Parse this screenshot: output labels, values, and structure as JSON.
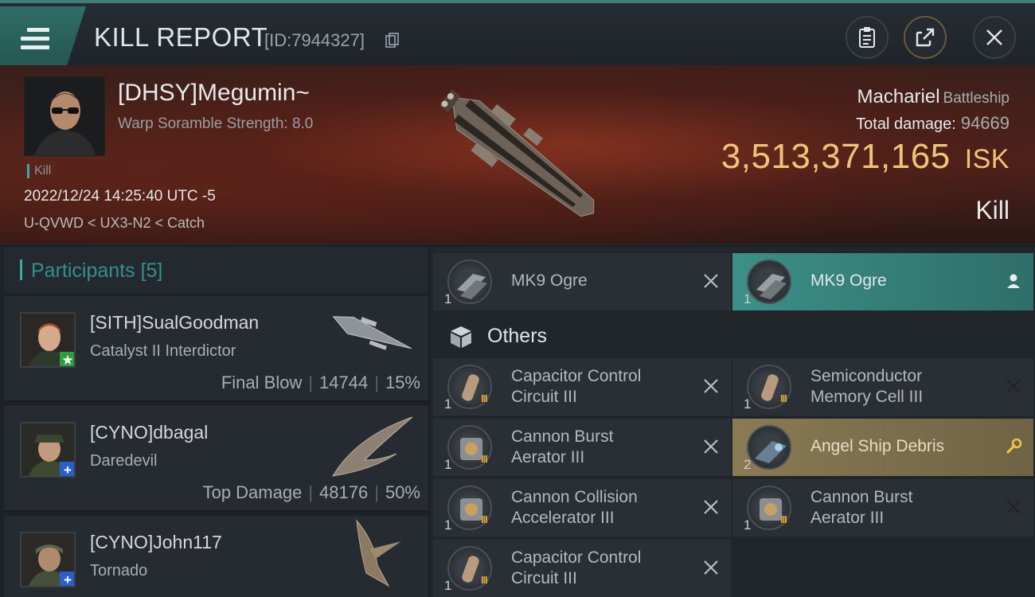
{
  "header": {
    "title": "KILL REPORT",
    "report_id": "[ID:7944327]"
  },
  "victim": {
    "name": "[DHSY]Megumin~",
    "scramble": "Warp Soramble Strength: 8.0",
    "kill_tag": "Kill",
    "datetime": "2022/12/24 14:25:40 UTC -5",
    "location": "U-QVWD < UX3-N2 < Catch",
    "ship_name": "Machariel",
    "ship_class": "Battleship",
    "total_damage_label": "Total damage:",
    "total_damage": "94669",
    "isk_value": "3,513,371,165",
    "isk_currency": "ISK",
    "result": "Kill"
  },
  "participants": {
    "label": "Participants",
    "count": "[5]",
    "list": [
      {
        "name": "[SITH]SualGoodman",
        "ship": "Catalyst II Interdictor",
        "role": "Final Blow",
        "damage": "14744",
        "percent": "15%",
        "badge": "★"
      },
      {
        "name": "[CYNO]dbagal",
        "ship": "Daredevil",
        "role": "Top Damage",
        "damage": "48176",
        "percent": "50%",
        "badge": "+"
      },
      {
        "name": "[CYNO]John117",
        "ship": "Tornado",
        "badge": "+"
      }
    ]
  },
  "items": {
    "others_label": "Others",
    "rows": [
      {
        "qty": "1",
        "name": [
          "MK9 Ogre"
        ],
        "tier": ""
      },
      {
        "qty": "1",
        "name": [
          "MK9 Ogre"
        ],
        "tier": ""
      },
      {
        "qty": "1",
        "name": [
          "Capacitor Control",
          "Circuit III"
        ],
        "tier": "III"
      },
      {
        "qty": "1",
        "name": [
          "Semiconductor",
          "Memory Cell III"
        ],
        "tier": "III"
      },
      {
        "qty": "1",
        "name": [
          "Cannon Burst",
          "Aerator III"
        ],
        "tier": "III"
      },
      {
        "qty": "2",
        "name": [
          "Angel Ship Debris"
        ],
        "tier": ""
      },
      {
        "qty": "1",
        "name": [
          "Cannon Collision",
          "Accelerator III"
        ],
        "tier": "III"
      },
      {
        "qty": "1",
        "name": [
          "Cannon Burst",
          "Aerator III"
        ],
        "tier": "III"
      },
      {
        "qty": "1",
        "name": [
          "Capacitor Control",
          "Circuit III"
        ],
        "tier": "III"
      }
    ]
  },
  "colors": {
    "accent_teal": "#3fa7a0",
    "isk_gold": "#f1c37a",
    "dropped_row": "#3c8f88",
    "debris_row": "#8a7a54"
  }
}
